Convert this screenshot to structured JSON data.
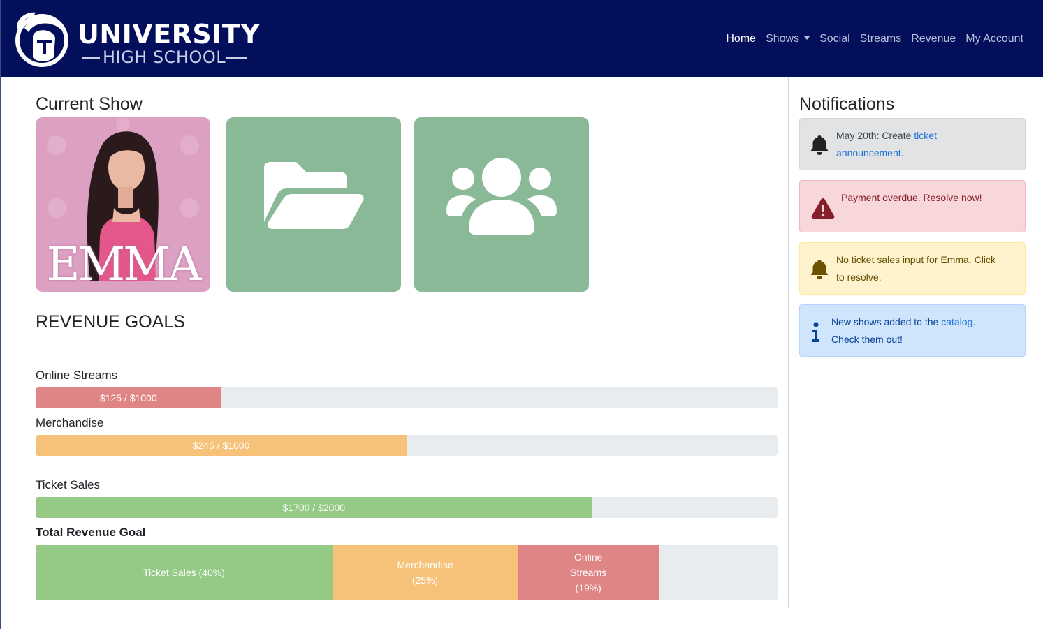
{
  "brand": {
    "title": "UNIVERSITY",
    "subtitle": "HIGH SCHOOL"
  },
  "nav": {
    "home": "Home",
    "shows": "Shows",
    "social": "Social",
    "streams": "Streams",
    "revenue": "Revenue",
    "account": "My Account"
  },
  "current_show": {
    "heading": "Current Show",
    "poster_title": "EMMA",
    "tiles": [
      "folder-icon",
      "users-icon"
    ]
  },
  "revenue": {
    "heading": "REVENUE GOALS",
    "goals": [
      {
        "label": "Online Streams",
        "bar_text": "$125 / $1000",
        "current": 125,
        "goal": 1000,
        "color": "#e08585"
      },
      {
        "label": "Merchandise",
        "bar_text": "$245 / $1000",
        "current": 245,
        "goal": 1000,
        "color": "#f6c27a"
      },
      {
        "label": "Ticket Sales",
        "bar_text": "$1700 / $2000",
        "current": 1700,
        "goal": 2000,
        "color": "#94ca86"
      }
    ],
    "total": {
      "label": "Total Revenue Goal",
      "segments": [
        {
          "line1": "Ticket Sales (40%)",
          "percent": 40,
          "color": "#94ca86"
        },
        {
          "line1": "Merchandise",
          "line2": "(25%)",
          "percent": 25,
          "color": "#f6c27a"
        },
        {
          "line1": "Online",
          "line2": "Streams",
          "line3": "(19%)",
          "percent": 19,
          "color": "#e08585"
        }
      ]
    }
  },
  "notifications": {
    "heading": "Notifications",
    "items": [
      {
        "type": "info-gray",
        "icon": "bell-icon",
        "text_before": "May 20th: Create ",
        "link": "ticket",
        "line2_link": "announcement",
        "line2_after": "."
      },
      {
        "type": "danger",
        "icon": "warning-icon",
        "text": "Payment overdue. Resolve now!"
      },
      {
        "type": "warning",
        "icon": "bell-icon",
        "line1": "No ticket sales input for Emma. Click",
        "line2": "to resolve."
      },
      {
        "type": "info",
        "icon": "info-icon",
        "text_before": "New shows added to the ",
        "link": "catalog",
        "text_after": ".",
        "line2": "Check them out!"
      }
    ]
  }
}
